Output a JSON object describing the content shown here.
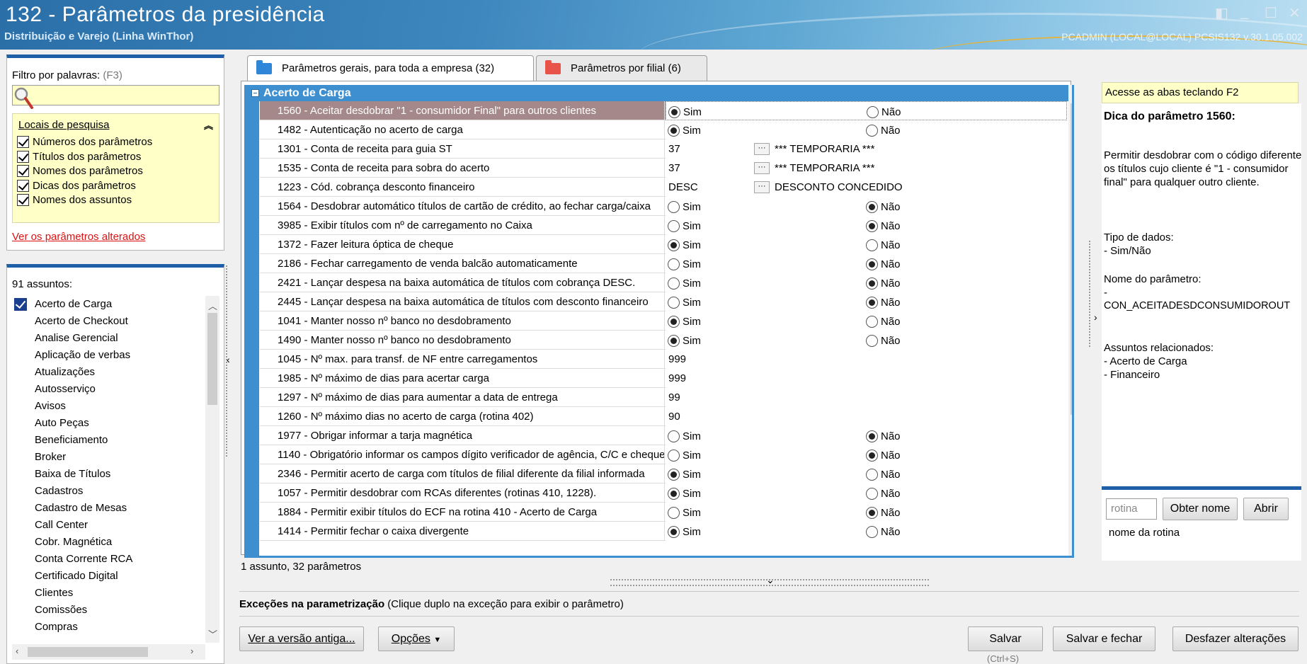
{
  "window": {
    "title": "132 - Parâmetros da presidência",
    "subtitle": "Distribuição e Varejo (Linha WinThor)",
    "session_info": "PCADMIN (LOCAL@LOCAL)   PCSIS132  v.30.1.05.002",
    "controls": [
      "◧",
      "_",
      "☐",
      "✕"
    ]
  },
  "filter": {
    "label": "Filtro por palavras:",
    "shortcut_hint": "(F3)",
    "search_value": "",
    "locais_title": "Locais de pesquisa",
    "options": [
      "Números dos parâmetros",
      "Títulos dos parâmetros",
      "Nomes dos parâmetros",
      "Dicas dos parâmetros",
      "Nomes dos assuntos"
    ],
    "changed_link": "Ver os parâmetros alterados"
  },
  "subjects": {
    "count_label": "91 assuntos:",
    "items": [
      "Acerto de Carga",
      "Acerto de Checkout",
      "Analise Gerencial",
      "Aplicação de verbas",
      "Atualizações",
      "Autosserviço",
      "Avisos",
      "Auto Peças",
      "Beneficiamento",
      "Broker",
      "Baixa de Títulos",
      "Cadastros",
      "Cadastro de Mesas",
      "Call Center",
      "Cobr. Magnética",
      "Conta Corrente RCA",
      "Certificado Digital",
      "Clientes",
      "Comissões",
      "Compras"
    ]
  },
  "tabs": [
    {
      "label": "Parâmetros gerais, para toda a empresa  (32)",
      "color": "#2f86d8"
    },
    {
      "label": "Parâmetros por filial  (6)",
      "color": "#e8544a"
    }
  ],
  "grid": {
    "group_title": "Acerto de Carga",
    "yes_label": "Sim",
    "no_label": "Não",
    "rows": [
      {
        "name": "1560 - Aceitar desdobrar \"1 - consumidor Final\" para outros clientes",
        "type": "bool",
        "value": "Sim"
      },
      {
        "name": "1482 - Autenticação no acerto de carga",
        "type": "bool",
        "value": "Sim"
      },
      {
        "name": "1301 - Conta de receita para guia ST",
        "type": "lookup",
        "value": "37",
        "desc": "*** TEMPORARIA ***"
      },
      {
        "name": "1535 - Conta de receita para sobra do acerto",
        "type": "lookup",
        "value": "37",
        "desc": "*** TEMPORARIA ***"
      },
      {
        "name": "1223 - Cód. cobrança desconto financeiro",
        "type": "lookup",
        "value": "DESC",
        "desc": "DESCONTO CONCEDIDO"
      },
      {
        "name": "1564 - Desdobrar automático títulos de cartão de crédito, ao fechar carga/caixa",
        "type": "bool",
        "value": "Não"
      },
      {
        "name": "3985 - Exibir títulos com nº de carregamento no Caixa",
        "type": "bool",
        "value": "Não"
      },
      {
        "name": "1372 - Fazer leitura óptica de cheque",
        "type": "bool",
        "value": "Sim"
      },
      {
        "name": "2186 - Fechar carregamento de venda balcão automaticamente",
        "type": "bool",
        "value": "Não"
      },
      {
        "name": "2421 - Lançar despesa na baixa automática de títulos com cobrança DESC.",
        "type": "bool",
        "value": "Não"
      },
      {
        "name": "2445 - Lançar despesa na baixa automática de títulos com desconto financeiro",
        "type": "bool",
        "value": "Não"
      },
      {
        "name": "1041 - Manter nosso nº banco no desdobramento",
        "type": "bool",
        "value": "Sim"
      },
      {
        "name": "1490 - Manter nosso nº banco no desdobramento",
        "type": "bool",
        "value": "Sim"
      },
      {
        "name": "1045 - Nº max. para transf. de NF entre carregamentos",
        "type": "text",
        "value": "999"
      },
      {
        "name": "1985 - Nº máximo de dias para acertar carga",
        "type": "text",
        "value": "999"
      },
      {
        "name": "1297 - Nº máximo de dias para aumentar a data de entrega",
        "type": "text",
        "value": "99"
      },
      {
        "name": "1260 - Nº máximo dias no acerto de carga (rotina 402)",
        "type": "text",
        "value": "90"
      },
      {
        "name": "1977 - Obrigar informar a tarja magnética",
        "type": "bool",
        "value": "Não"
      },
      {
        "name": "1140 - Obrigatório informar os campos dígito verificador de agência, C/C e cheque",
        "type": "bool",
        "value": "Não"
      },
      {
        "name": "2346 - Permitir acerto de carga com títulos de filial diferente da filial informada",
        "type": "bool",
        "value": "Sim"
      },
      {
        "name": "1057 - Permitir desdobrar com RCAs diferentes (rotinas 410, 1228).",
        "type": "bool",
        "value": "Sim"
      },
      {
        "name": "1884 - Permitir exibir títulos do ECF na rotina 410 - Acerto de Carga",
        "type": "bool",
        "value": "Não"
      },
      {
        "name": "1414 - Permitir fechar o caixa divergente",
        "type": "bool",
        "value": "Sim"
      }
    ]
  },
  "status": "1 assunto, 32 parâmetros",
  "exceptions": {
    "title": "Exceções na parametrização",
    "hint": "(Clique duplo na exceção para exibir o parâmetro)"
  },
  "buttons": {
    "old_version": "Ver a versão antiga...",
    "options": "Opções",
    "save": "Salvar",
    "save_shortcut": "(Ctrl+S)",
    "save_close": "Salvar e fechar",
    "undo": "Desfazer alterações"
  },
  "tip": {
    "access_hint": "Acesse as abas teclando F2",
    "title": "Dica do parâmetro 1560:",
    "description": "Permitir desdobrar com o código diferente os títulos cujo cliente é \"1 - consumidor final\" para qualquer outro cliente.",
    "data_type_label": "Tipo de dados:",
    "data_type": "- Sim/Não",
    "param_name_label": "Nome do parâmetro:",
    "param_name_dash": "-",
    "param_name": "CON_ACEITADESDCONSUMIDOROUT",
    "related_label": "Assuntos relacionados:",
    "related": [
      "- Acerto de Carga",
      "- Financeiro"
    ]
  },
  "routine": {
    "placeholder": "rotina",
    "get_name_button": "Obter nome",
    "open_button": "Abrir",
    "caption": "nome da rotina"
  }
}
